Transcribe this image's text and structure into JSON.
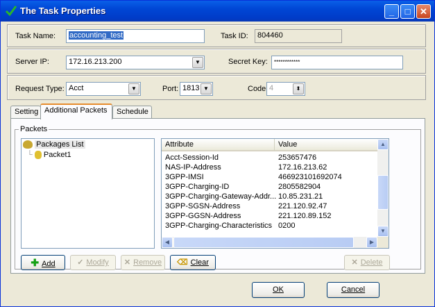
{
  "window": {
    "title": "The Task Properties",
    "controls": {
      "minimize": "_",
      "maximize": "□",
      "close": "✕"
    }
  },
  "task": {
    "name_label": "Task Name:",
    "name_value": "accounting_test",
    "id_label": "Task ID:",
    "id_value": "804460"
  },
  "server": {
    "ip_label": "Server IP:",
    "ip_value": "172.16.213.200",
    "secret_label": "Secret Key:",
    "secret_value": "************"
  },
  "request": {
    "type_label": "Request Type:",
    "type_value": "Acct",
    "port_label": "Port:",
    "port_value": "1813",
    "code_label": "Code:",
    "code_value": "4"
  },
  "tabs": [
    {
      "label": "Setting"
    },
    {
      "label": "Additional Packets"
    },
    {
      "label": "Schedule"
    }
  ],
  "packets": {
    "group_label": "Packets",
    "tree_root": "Packages List",
    "tree_child": "Packet1",
    "columns": [
      "Attribute",
      "Value"
    ],
    "rows": [
      [
        "Acct-Session-Id",
        "253657476"
      ],
      [
        "NAS-IP-Address",
        "172.16.213.62"
      ],
      [
        "3GPP-IMSI",
        "466923101692074"
      ],
      [
        "3GPP-Charging-ID",
        "2805582904"
      ],
      [
        "3GPP-Charging-Gateway-Addr...",
        "10.85.231.21"
      ],
      [
        "3GPP-SGSN-Address",
        "221.120.92.47"
      ],
      [
        "3GPP-GGSN-Address",
        "221.120.89.152"
      ],
      [
        "3GPP-Charging-Characteristics",
        "0200"
      ]
    ]
  },
  "buttons": {
    "add": "Add",
    "modify": "Modify",
    "remove": "Remove",
    "clear": "Clear",
    "delete": "Delete",
    "ok": "OK",
    "cancel": "Cancel"
  },
  "colors": {
    "titlebar": "#0054e3",
    "window_bg": "#ece9d8",
    "selection": "#316ac5"
  }
}
